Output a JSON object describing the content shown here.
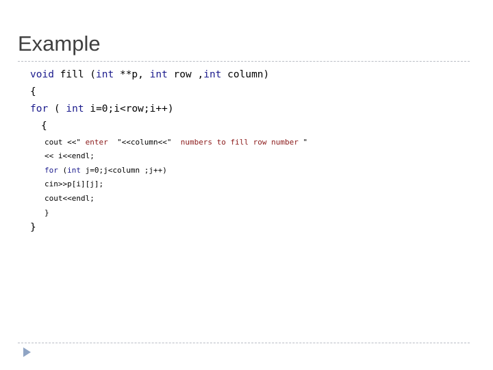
{
  "slide": {
    "title": "Example"
  },
  "code": {
    "lines": [
      {
        "tokens": [
          {
            "t": "void",
            "k": "kw"
          },
          {
            "t": " fill (",
            "k": ""
          },
          {
            "t": "int",
            "k": "kw"
          },
          {
            "t": " **p, ",
            "k": ""
          },
          {
            "t": "int",
            "k": "kw"
          },
          {
            "t": " row ,",
            "k": ""
          },
          {
            "t": "int",
            "k": "kw"
          },
          {
            "t": " column)",
            "k": ""
          }
        ]
      },
      {
        "tokens": [
          {
            "t": "{",
            "k": ""
          }
        ]
      },
      {
        "tokens": [
          {
            "t": "for",
            "k": "kw"
          },
          {
            "t": " ( ",
            "k": ""
          },
          {
            "t": "int",
            "k": "kw"
          },
          {
            "t": " i=0;i<row;i++)",
            "k": ""
          }
        ]
      },
      {
        "tokens": [
          {
            "t": "{",
            "k": ""
          }
        ]
      },
      {
        "tokens": [
          {
            "t": "cout <<\"",
            "k": ""
          },
          {
            "t": " enter  ",
            "k": "str"
          },
          {
            "t": "\"<<column<<\"",
            "k": ""
          },
          {
            "t": "  numbers to fill row number ",
            "k": "str"
          },
          {
            "t": "\"",
            "k": ""
          }
        ]
      },
      {
        "tokens": [
          {
            "t": "<< i<<endl;",
            "k": ""
          }
        ]
      },
      {
        "tokens": [
          {
            "t": "for",
            "k": "kw"
          },
          {
            "t": " (",
            "k": ""
          },
          {
            "t": "int",
            "k": "kw"
          },
          {
            "t": " j=0;j<column ;j++)",
            "k": ""
          }
        ]
      },
      {
        "tokens": [
          {
            "t": "cin>>p[i][j];",
            "k": ""
          }
        ]
      },
      {
        "tokens": [
          {
            "t": "cout<<endl;",
            "k": ""
          }
        ]
      },
      {
        "tokens": [
          {
            "t": "}",
            "k": ""
          }
        ]
      },
      {
        "tokens": [
          {
            "t": "}",
            "k": ""
          }
        ]
      }
    ]
  },
  "nav": {
    "next_icon": "triangle-right-icon"
  },
  "colors": {
    "keyword": "#1a1a8c",
    "string": "#8b1a1a",
    "title": "#404040",
    "nav_arrow": "#8fa4c4"
  }
}
